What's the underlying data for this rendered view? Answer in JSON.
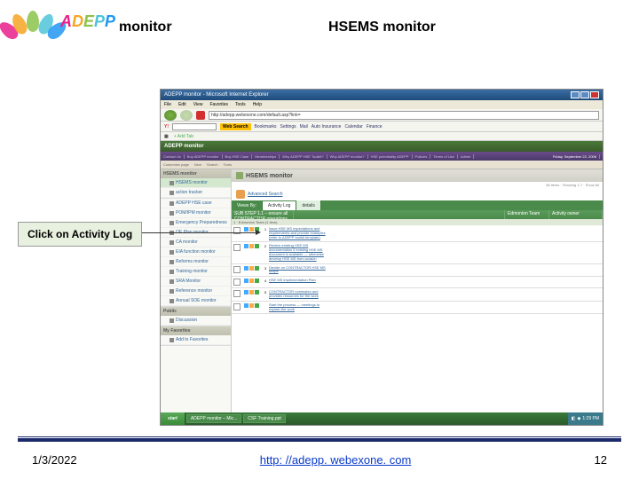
{
  "header": {
    "logo_text": "ADEPP",
    "subtitle": "monitor",
    "title": "HSEMS monitor"
  },
  "callout": {
    "label": "Click on Activity Log"
  },
  "browser": {
    "titlebar": "ADEPP monitor - Microsoft Internet Explorer",
    "menu": [
      "File",
      "Edit",
      "View",
      "Favorites",
      "Tools",
      "Help"
    ],
    "address": "http://adepp.webexone.com/default.asp?link=",
    "search_label": "Web Search",
    "toolbar_links": [
      "Bookmarks",
      "Settings",
      "Mail",
      "Auto Insurance",
      "Calendar",
      "Finance"
    ],
    "tab_label": "Add Tab"
  },
  "app": {
    "header": "ADEPP monitor",
    "nav": [
      "Contact Us",
      "Buy ADEPP monitor",
      "Buy HSE Case",
      "Memberships",
      "Why ADEPP HSE Toolkit?",
      "Why ADEPP monitor?",
      "HSE potentiality ADEPP",
      "Policies",
      "Terms of Use",
      "Admin"
    ],
    "nav_date": "Friday, September 22, 2006",
    "subnav": [
      "Customize page",
      "New",
      "Search",
      "Tools"
    ]
  },
  "sidebar": {
    "sections": [
      {
        "header": "HSEMS monitor",
        "items": [
          "HSEMS monitor",
          "action tracker"
        ]
      },
      {
        "header": "",
        "items": [
          "ADEPP HSE case",
          "POM/IPM monitor",
          "Emergency Preparedness",
          "OE Plan monitor",
          "CA monitor",
          "EIA function monitor",
          "Reforms monitor",
          "Training monitor",
          "SRA Monitor",
          "Reference monitor",
          "Annual SOE monitor"
        ]
      },
      {
        "header": "Public",
        "items": [
          "Discussion"
        ]
      },
      {
        "header": "My Favorites",
        "items": [
          "Add to Favorites"
        ]
      }
    ]
  },
  "content": {
    "title": "HSEMS monitor",
    "meta": "56 items · Showing 1-7 · Show All",
    "adv_search": "Advanced Search",
    "tabs": [
      "Views By:",
      "Activity Log",
      "details"
    ],
    "list_headers": [
      "SUB STEP 1.1 – ensure all CONTRACTOR operations are covered by HSE MS documentation",
      "",
      "Edmonton Team",
      "Activity owner"
    ],
    "group": "1 · Edmonton Team (1 item)",
    "rows": [
      {
        "n": "1",
        "text": "Issue HSE MS expectations and requirements and provide examples (refer to ADEPP toolkit template)"
      },
      {
        "n": "2",
        "text": "Review existing HSE MS documentation if existing HSE MS document is available — otherwise develop HSE MS from scratch"
      },
      {
        "n": "3",
        "text": "Decide on CONTRACTOR HSE MS scope"
      },
      {
        "n": "4",
        "text": "HSE MS implementation Plan"
      },
      {
        "n": "5",
        "text": "CONTRACTOR nominates and provides resources for the work"
      },
      {
        "n": "",
        "text": "Start the process — meetings to explain the work"
      }
    ]
  },
  "taskbar": {
    "start": "start",
    "items": [
      "ADEPP monitor – Mic...",
      "CSF Training.ppt"
    ],
    "clock": "1:29 PM"
  },
  "footer": {
    "date": "1/3/2022",
    "link": "http: //adepp. webexone. com",
    "page": "12"
  }
}
